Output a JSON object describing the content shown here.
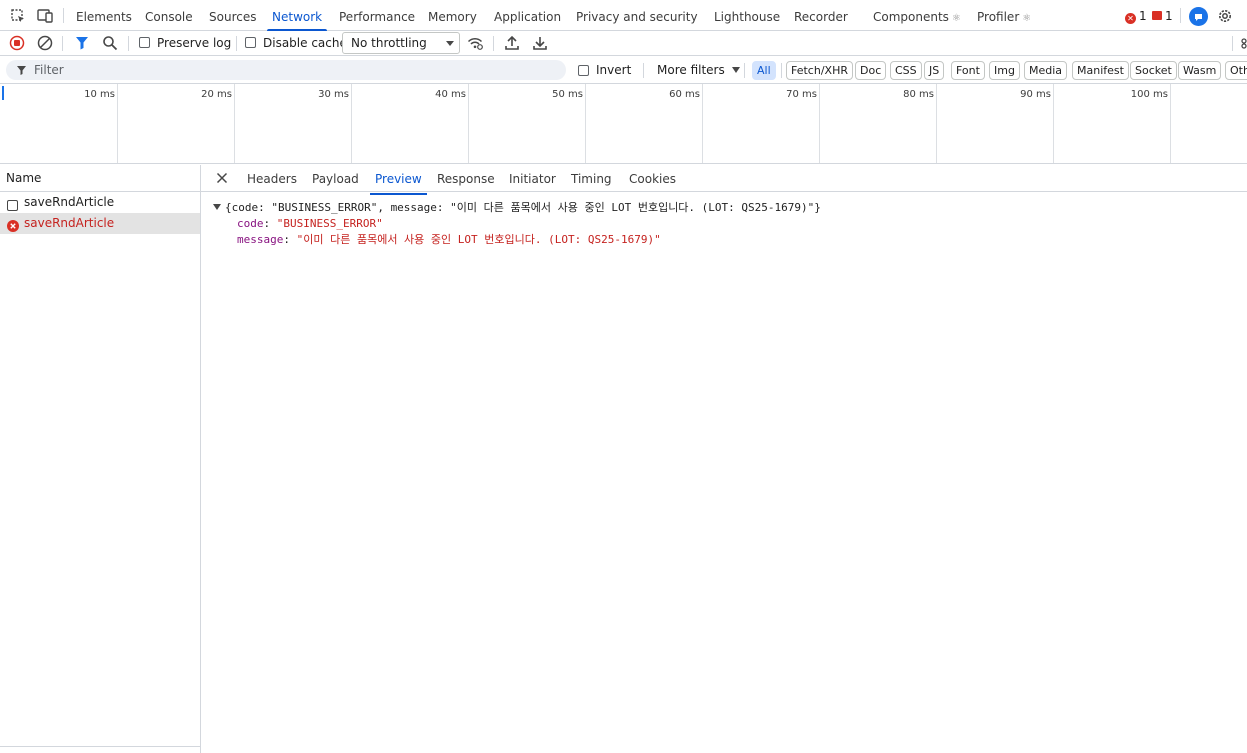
{
  "tabs": [
    {
      "label": "Elements"
    },
    {
      "label": "Console"
    },
    {
      "label": "Sources"
    },
    {
      "label": "Network"
    },
    {
      "label": "Performance"
    },
    {
      "label": "Memory"
    },
    {
      "label": "Application"
    },
    {
      "label": "Privacy and security"
    },
    {
      "label": "Lighthouse"
    },
    {
      "label": "Recorder"
    },
    {
      "label": "Components"
    },
    {
      "label": "Profiler"
    }
  ],
  "active_tab": "Network",
  "react_mark": "⚛",
  "status": {
    "errors": "1",
    "issues": "1"
  },
  "toolbar": {
    "preserve_log": "Preserve log",
    "disable_cache": "Disable cache",
    "throttling": "No throttling"
  },
  "filter": {
    "placeholder": "Filter",
    "invert": "Invert",
    "more_filters": "More filters",
    "chips": [
      "All",
      "Fetch/XHR",
      "Doc",
      "CSS",
      "JS",
      "Font",
      "Img",
      "Media",
      "Manifest",
      "Socket",
      "Wasm",
      "Oth"
    ],
    "active_chip": "All"
  },
  "timeline": {
    "ticks": [
      "10 ms",
      "20 ms",
      "30 ms",
      "40 ms",
      "50 ms",
      "60 ms",
      "70 ms",
      "80 ms",
      "90 ms",
      "100 ms"
    ]
  },
  "requests": {
    "column": "Name",
    "rows": [
      {
        "name": "saveRndArticle",
        "status": "pending"
      },
      {
        "name": "saveRndArticle",
        "status": "error"
      }
    ]
  },
  "detail": {
    "tabs": [
      "Headers",
      "Payload",
      "Preview",
      "Response",
      "Initiator",
      "Timing",
      "Cookies"
    ],
    "active": "Preview",
    "preview": {
      "summary": "{code: \"BUSINESS_ERROR\", message: \"이미 다른 품목에서 사용 중인 LOT 번호입니다. (LOT: QS25-1679)\"}",
      "fields": [
        {
          "key": "code",
          "value": "\"BUSINESS_ERROR\""
        },
        {
          "key": "message",
          "value": "\"이미 다른 품목에서 사용 중인 LOT 번호입니다. (LOT: QS25-1679)\""
        }
      ]
    }
  },
  "colors": {
    "accent": "#0b57d0",
    "error": "#d93025",
    "key": "#881280",
    "string": "#c5221f"
  }
}
